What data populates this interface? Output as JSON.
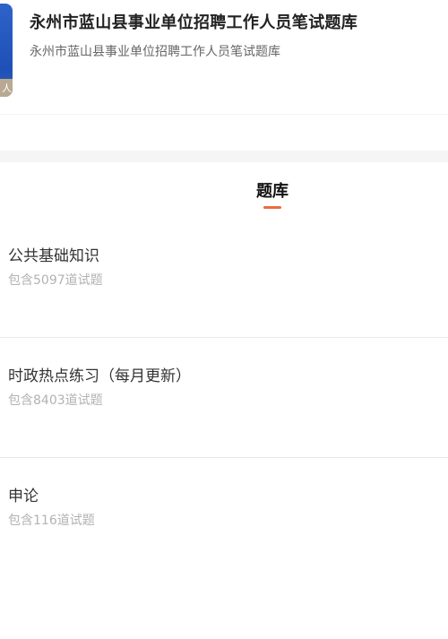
{
  "header": {
    "cover_band_text": "人",
    "title": "永州市蓝山县事业单位招聘工作人员笔试题库",
    "subtitle": "永州市蓝山县事业单位招聘工作人员笔试题库"
  },
  "tab": {
    "label": "题库"
  },
  "items": [
    {
      "title": "公共基础知识",
      "count": "包含5097道试题"
    },
    {
      "title": "时政热点练习（每月更新）",
      "count": "包含8403道试题"
    },
    {
      "title": "申论",
      "count": "包含116道试题"
    }
  ],
  "colors": {
    "accent": "#ee6a3e",
    "cover_blue": "#1f50b8"
  }
}
